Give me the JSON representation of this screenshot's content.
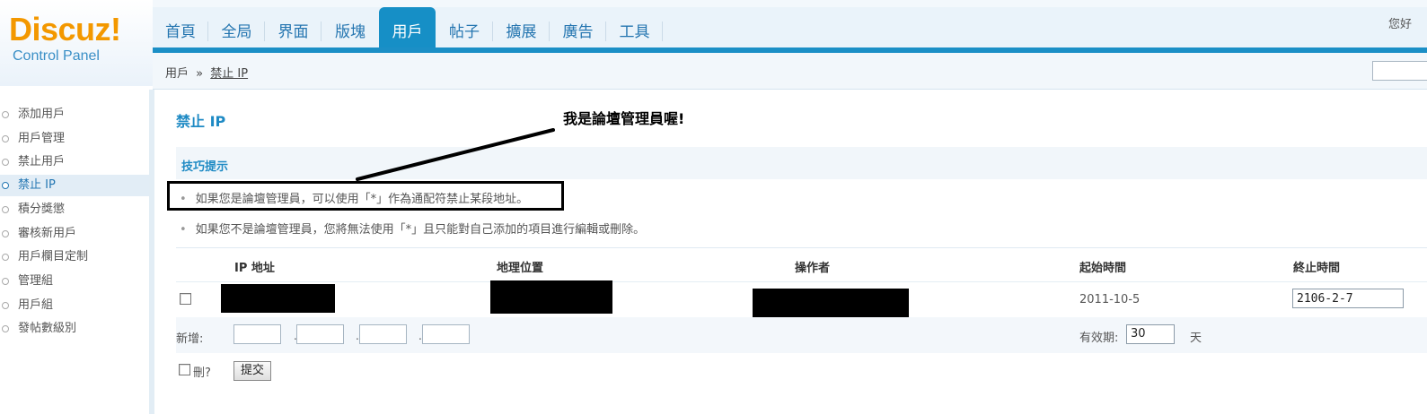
{
  "logo": {
    "brand": "Discuz!",
    "subtitle": "Control Panel"
  },
  "topnav": {
    "tabs": [
      {
        "label": "首頁"
      },
      {
        "label": "全局"
      },
      {
        "label": "界面"
      },
      {
        "label": "版塊"
      },
      {
        "label": "用戶",
        "active": true
      },
      {
        "label": "帖子"
      },
      {
        "label": "擴展"
      },
      {
        "label": "廣告"
      },
      {
        "label": "工具"
      }
    ],
    "greeting": "您好"
  },
  "breadcrumb": {
    "parent": "用戶",
    "separator": "»",
    "current": "禁止 IP"
  },
  "sidebar": {
    "items": [
      {
        "label": "添加用戶"
      },
      {
        "label": "用戶管理"
      },
      {
        "label": "禁止用戶"
      },
      {
        "label": "禁止 IP",
        "active": true
      },
      {
        "label": "積分獎懲"
      },
      {
        "label": "審核新用戶"
      },
      {
        "label": "用戶欄目定制"
      },
      {
        "label": "管理組"
      },
      {
        "label": "用戶組"
      },
      {
        "label": "發帖數級別"
      }
    ]
  },
  "main": {
    "title": "禁止 IP",
    "annotation": "我是論壇管理員喔!",
    "tips": {
      "title": "技巧提示",
      "items": [
        "如果您是論壇管理員，可以使用「*」作為通配符禁止某段地址。",
        "如果您不是論壇管理員，您將無法使用「*」且只能對自己添加的項目進行編輯或刪除。"
      ]
    },
    "table": {
      "headers": [
        "IP 地址",
        "地理位置",
        "操作者",
        "起始時間",
        "終止時間"
      ],
      "rows": [
        {
          "ip": "",
          "location": "",
          "operator": "",
          "start": "2011-10-5",
          "end": "2106-2-7"
        }
      ]
    },
    "add_row": {
      "label": "新增:",
      "valid_label": "有效期:",
      "valid_value": "30",
      "days_label": "天"
    },
    "footer": {
      "delete_label": "刪?",
      "submit_label": "提交"
    }
  },
  "colors": {
    "accent": "#168fc6",
    "logo": "#f39800",
    "annotation_box": "#000000"
  }
}
